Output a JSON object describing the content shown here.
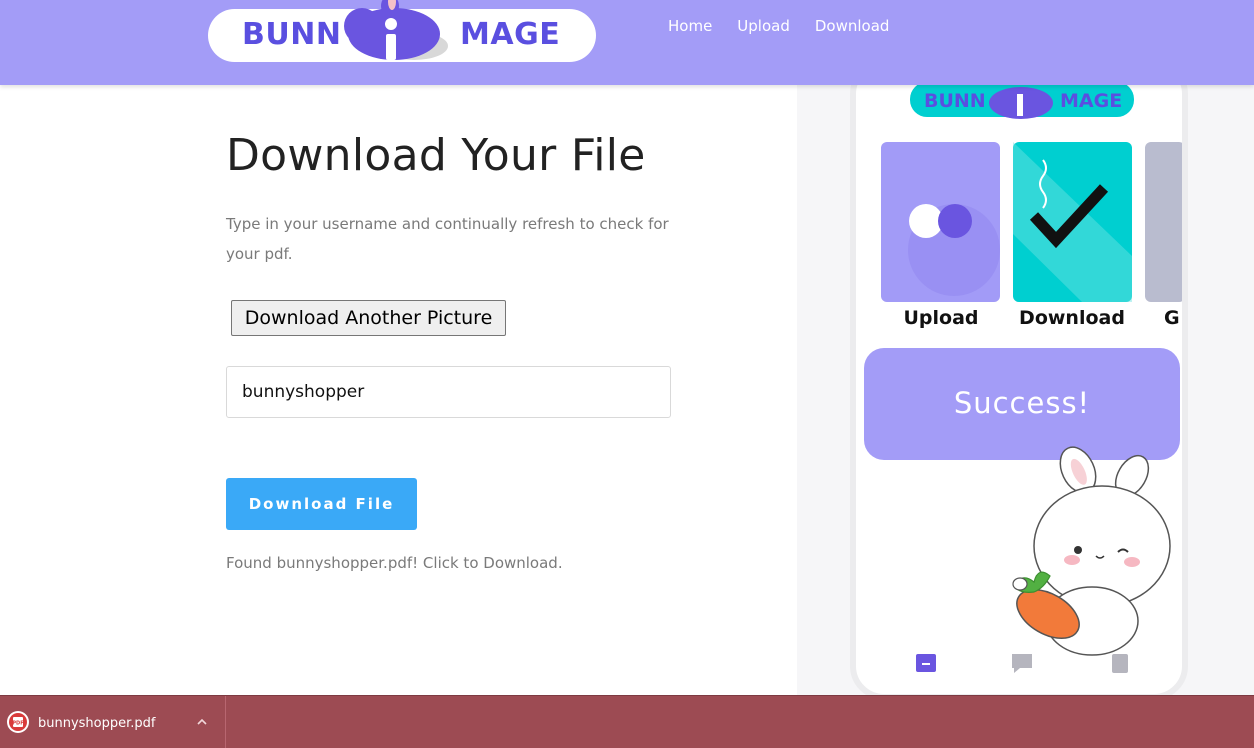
{
  "header": {
    "logo_left": "BUNN",
    "logo_right": "MAGE",
    "nav": [
      "Home",
      "Upload",
      "Download"
    ]
  },
  "main": {
    "title": "Download Your File",
    "description": "Type in your username and continually refresh to check for your pdf.",
    "another_button": "Download Another Picture",
    "username_value": "bunnyshopper",
    "download_button": "Download File",
    "found_message": "Found bunnyshopper.pdf! Click to Download."
  },
  "phone": {
    "logo_left": "BUNN",
    "logo_right": "MAGE",
    "cards": [
      "Upload",
      "Download",
      "G"
    ],
    "success": "Success!"
  },
  "download_bar": {
    "file_name": "bunnyshopper.pdf",
    "file_icon": "pdf-file-icon"
  },
  "colors": {
    "header": "#a39cf7",
    "logo_text": "#5a4fe0",
    "button_blue": "#3aa9f7",
    "teal": "#00cfd0",
    "download_bar": "#9d4b53"
  }
}
